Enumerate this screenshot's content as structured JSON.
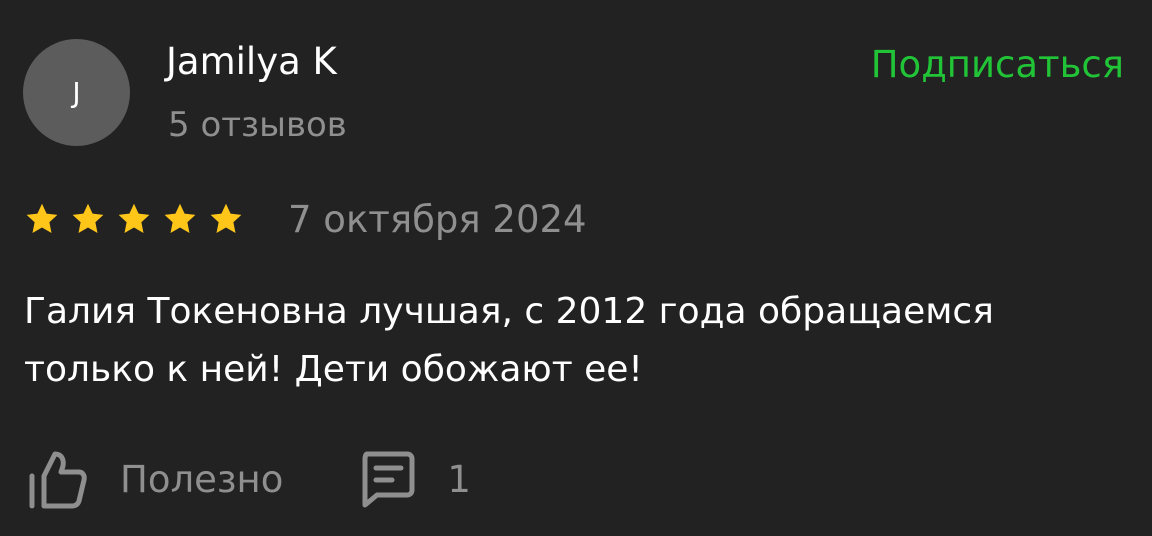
{
  "review": {
    "author": {
      "initial": "J",
      "name": "Jamilya K",
      "reviews_count": "5 отзывов"
    },
    "subscribe_label": "Подписаться",
    "rating": {
      "stars": 5,
      "max": 5,
      "icon": "star-icon"
    },
    "date": "7 октября 2024",
    "text": "Галия Токеновна лучшая, с 2012 года обращаемся только к ней! Дети обожают ее!",
    "actions": {
      "helpful_label": "Полезно",
      "helpful_icon": "thumbs-up-icon",
      "comments_icon": "comment-icon",
      "comments_count": "1"
    }
  },
  "colors": {
    "background": "#222222",
    "accent": "#22c437",
    "star": "#ffc61a",
    "muted_text": "#8f8f8f",
    "avatar_bg": "#5c5c5c"
  }
}
